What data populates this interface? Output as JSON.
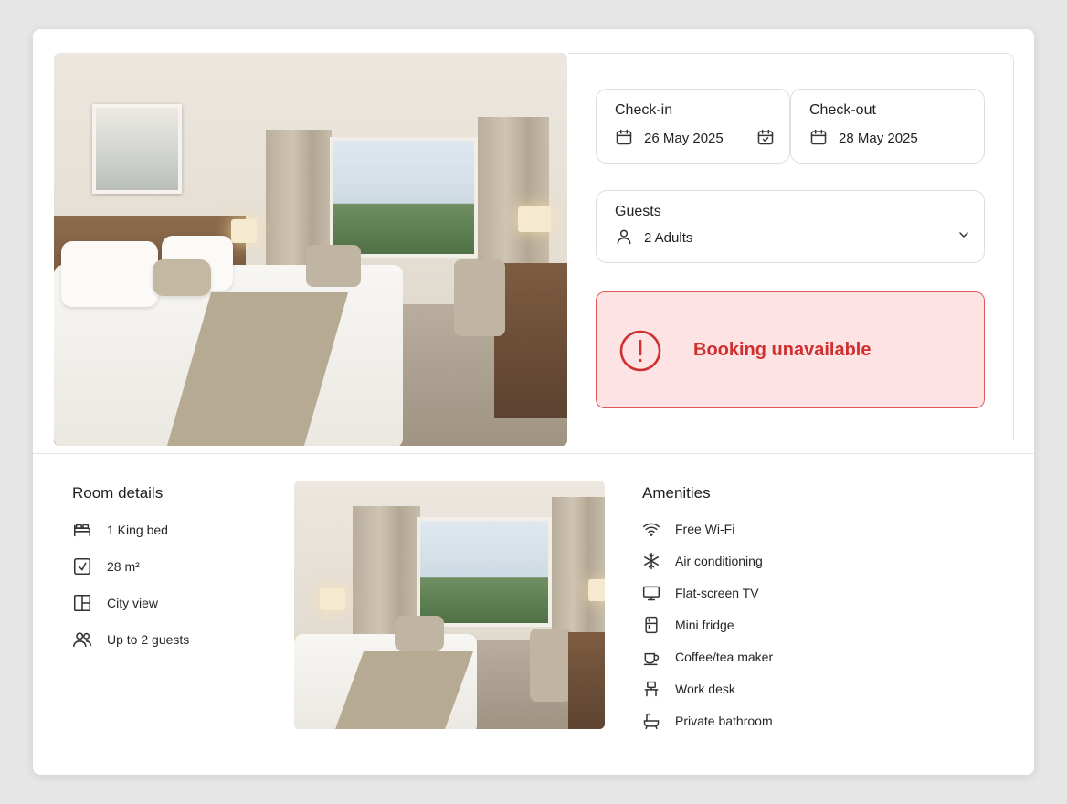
{
  "booking": {
    "checkin": {
      "label": "Check-in",
      "value": "26 May 2025"
    },
    "checkout": {
      "label": "Check-out",
      "value": "28 May 2025"
    },
    "guests": {
      "label": "Guests",
      "value": "2 Adults"
    },
    "alert": {
      "text": "Booking unavailable",
      "color": "#cf2f2f",
      "background": "#fde3e3"
    }
  },
  "room_details": {
    "title": "Room details",
    "items": [
      {
        "icon": "bed-icon",
        "label": "1 King bed"
      },
      {
        "icon": "room-size-icon",
        "label": "28 m²"
      },
      {
        "icon": "window-icon",
        "label": "City view"
      },
      {
        "icon": "guests-icon",
        "label": "Up to 2 guests"
      }
    ]
  },
  "amenities": {
    "title": "Amenities",
    "items": [
      {
        "icon": "wifi-icon",
        "label": "Free Wi-Fi"
      },
      {
        "icon": "snowflake-icon",
        "label": "Air conditioning"
      },
      {
        "icon": "tv-icon",
        "label": "Flat-screen TV"
      },
      {
        "icon": "fridge-icon",
        "label": "Mini fridge"
      },
      {
        "icon": "coffee-cup-icon",
        "label": "Coffee/tea maker"
      },
      {
        "icon": "desk-icon",
        "label": "Work desk"
      },
      {
        "icon": "bathtub-icon",
        "label": "Private bathroom"
      }
    ]
  }
}
